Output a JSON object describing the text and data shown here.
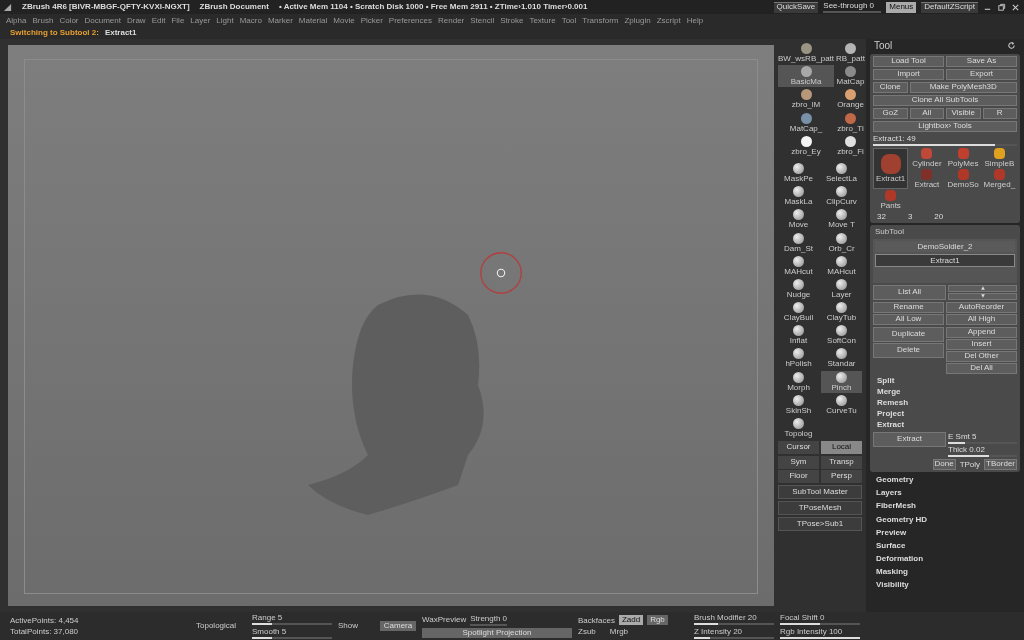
{
  "title_bar": {
    "app": "ZBrush 4R6 [BIVR-MBGF-QFTY-KVXI-NGXT]",
    "document": "ZBrush Document",
    "stats": "• Active Mem 1104 • Scratch Disk 1000 • Free Mem 2911 • ZTime›1.010 Timer›0.001",
    "quicksave": "QuickSave",
    "see_through": {
      "label": "See-through",
      "value": "0",
      "level": 0
    },
    "menus": {
      "label": "Menus",
      "selected": true
    },
    "script": "DefaultZScript"
  },
  "menu_bar": [
    "Alpha",
    "Brush",
    "Color",
    "Document",
    "Draw",
    "Edit",
    "File",
    "Layer",
    "Light",
    "Macro",
    "Marker",
    "Material",
    "Movie",
    "Picker",
    "Preferences",
    "Render",
    "Stencil",
    "Stroke",
    "Texture",
    "Tool",
    "Transform",
    "Zplugin",
    "Zscript",
    "Help"
  ],
  "status": {
    "message": "Switching to Subtool 2:",
    "target": "Extract1"
  },
  "shelf": {
    "materials": [
      {
        "label": "BW_wsRB_patt",
        "color": "#9a9482",
        "selected": false
      },
      {
        "label": "RB_patt",
        "color": "#b4b4b4",
        "selected": false
      },
      {
        "label": "BasicMa",
        "color": "#a8a8a8",
        "selected": true
      },
      {
        "label": "MatCap",
        "color": "#8a8a8a",
        "selected": false
      },
      {
        "label": "zbro_lM",
        "color": "#b8987a",
        "selected": false
      },
      {
        "label": "Orange",
        "color": "#d8a070",
        "selected": false
      },
      {
        "label": "MatCap_",
        "color": "#7890a8",
        "selected": false
      },
      {
        "label": "zbro_Ti",
        "color": "#c06848",
        "selected": false
      },
      {
        "label": "zbro_Ey",
        "color": "#f4f4f4",
        "selected": false
      },
      {
        "label": "zbro_Fi",
        "color": "#e0e0e0",
        "selected": false
      }
    ],
    "brushes": [
      {
        "label": "MaskPe",
        "selected": false
      },
      {
        "label": "SelectLa",
        "selected": false
      },
      {
        "label": "MaskLa",
        "selected": false
      },
      {
        "label": "ClipCurv",
        "selected": false
      },
      {
        "label": "Move",
        "selected": false
      },
      {
        "label": "Move T",
        "selected": false
      },
      {
        "label": "Dam_St",
        "selected": false
      },
      {
        "label": "Orb_Cr",
        "selected": false
      },
      {
        "label": "MAHcut",
        "selected": false
      },
      {
        "label": "MAHcut",
        "selected": false
      },
      {
        "label": "Nudge",
        "selected": false
      },
      {
        "label": "Layer",
        "selected": false
      },
      {
        "label": "ClayBuil",
        "selected": false
      },
      {
        "label": "ClayTub",
        "selected": false
      },
      {
        "label": "Inflat",
        "selected": false
      },
      {
        "label": "SoftCon",
        "selected": false
      },
      {
        "label": "hPolish",
        "selected": false
      },
      {
        "label": "Standar",
        "selected": false
      },
      {
        "label": "Morph",
        "selected": false
      },
      {
        "label": "Pinch",
        "selected": true
      },
      {
        "label": "SkinSh",
        "selected": false
      },
      {
        "label": "CurveTu",
        "selected": false
      },
      {
        "label": "Topolog",
        "selected": false
      }
    ],
    "toggles": [
      {
        "label": "Cursor",
        "on": false
      },
      {
        "label": "Local",
        "on": true
      }
    ],
    "view": [
      "Sym",
      "Transp",
      "Floor",
      "Persp"
    ],
    "buttons": [
      "SubTool Master",
      "TPoseMesh",
      "TPose>Sub1"
    ]
  },
  "tool_panel": {
    "title": "Tool",
    "buttons": [
      "Load Tool",
      "Save As",
      "Import",
      "Export",
      "Clone",
      "Make PolyMesh3D",
      "Clone All SubTools",
      "GoZ",
      "All",
      "Visible",
      "R",
      "Lightbox› Tools"
    ],
    "current": {
      "label": "Extract1:",
      "value": "49",
      "level": 0.85
    },
    "tools": [
      {
        "label": "Extract1",
        "color": "#a04030",
        "selected": true
      },
      {
        "label": "Cylinder",
        "color": "#c04838",
        "selected": false
      },
      {
        "label": "PolyMes",
        "color": "#c04030",
        "selected": false
      },
      {
        "label": "SimpleB",
        "color": "#e0a020",
        "selected": false
      },
      {
        "label": "Extract",
        "color": "#803028",
        "selected": false
      },
      {
        "label": "DemoSo",
        "color": "#b03828",
        "selected": false
      },
      {
        "label": "Merged_",
        "color": "#b03828",
        "selected": false
      },
      {
        "label": "Pants",
        "color": "#b03828",
        "selected": false
      }
    ],
    "tool_counts": [
      "32",
      "3",
      "20"
    ]
  },
  "subtool": {
    "title": "SubTool",
    "items": [
      {
        "name": "DemoSoldier_2",
        "selected": false
      },
      {
        "name": "Extract1",
        "selected": true
      }
    ],
    "list_all": "List All",
    "actions": [
      "Rename",
      "AutoReorder",
      "All Low",
      "All High"
    ],
    "duplicate": "Duplicate",
    "delete": "Delete",
    "side": [
      "Append",
      "Insert",
      "Del Other",
      "Del All"
    ],
    "sections": [
      "Split",
      "Merge",
      "Remesh",
      "Project",
      "Extract"
    ],
    "extract": {
      "button": "Extract",
      "smt": {
        "label": "E Smt",
        "value": "5",
        "level": 0.25
      },
      "thick": {
        "label": "Thick",
        "value": "0.02",
        "level": 0.6
      },
      "done": "Done",
      "tborder": "TBorder",
      "tborder_label": "TPoly"
    }
  },
  "palettes": [
    "Geometry",
    "Layers",
    "FiberMesh",
    "Geometry HD",
    "Preview",
    "Surface",
    "Deformation",
    "Masking",
    "Visibility"
  ],
  "bottom_bar": {
    "active_points": "ActivePoints: 4,454",
    "total_points": "TotalPoints: 37,080",
    "topological": "Topological",
    "sliders": [
      {
        "label": "Range",
        "value": "5",
        "level": 0.25
      },
      {
        "label": "Smooth",
        "value": "5",
        "level": 0.25
      },
      {
        "label": "Strength",
        "value": "0",
        "level": 0
      },
      {
        "label": "Brush Modifier",
        "value": "20",
        "level": 0.3
      },
      {
        "label": "Z Intensity",
        "value": "20",
        "level": 0.2
      },
      {
        "label": "Focal Shift",
        "value": "0",
        "level": 0.5
      },
      {
        "label": "Rgb Intensity",
        "value": "100",
        "level": 1
      }
    ],
    "show": "Show",
    "camera": "Camera",
    "wax": "WaxPreview",
    "spotlight": "Spotlight Projection",
    "backfaces": "Backfaces",
    "zadd": {
      "label": "Zadd",
      "selected": true
    },
    "rgb": {
      "label": "Rgb",
      "selected": false
    },
    "zsub": "Zsub",
    "mrgb": "Mrgb"
  }
}
